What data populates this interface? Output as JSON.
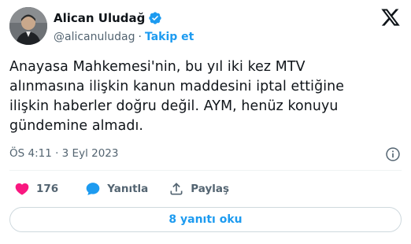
{
  "author": {
    "display_name": "Alican Uludağ",
    "handle": "@alicanuludag",
    "separator": "·",
    "follow_label": "Takip et"
  },
  "tweet": {
    "text_lines": [
      "Anayasa Mahkemesi'nin, bu yıl iki kez MTV",
      "alınmasına ilişkin kanun maddesini iptal ettiğine",
      "ilişkin haberler doğru değil. AYM, henüz konuyu",
      "gündemine almadı."
    ],
    "timestamp": "ÖS 4:11 · 3 Eyl 2023"
  },
  "actions": {
    "like_count": "176",
    "reply_label": "Yanıtla",
    "share_label": "Paylaş"
  },
  "replies_button": {
    "label": "8 yanıtı oku"
  },
  "colors": {
    "accent": "#1d9bf0",
    "like": "#f91880",
    "text": "#0f1419",
    "muted": "#536471",
    "border": "#cfd9de"
  },
  "icons": [
    "verified-badge-icon",
    "x-logo-icon",
    "info-icon",
    "heart-icon",
    "reply-bubble-icon",
    "share-icon"
  ]
}
